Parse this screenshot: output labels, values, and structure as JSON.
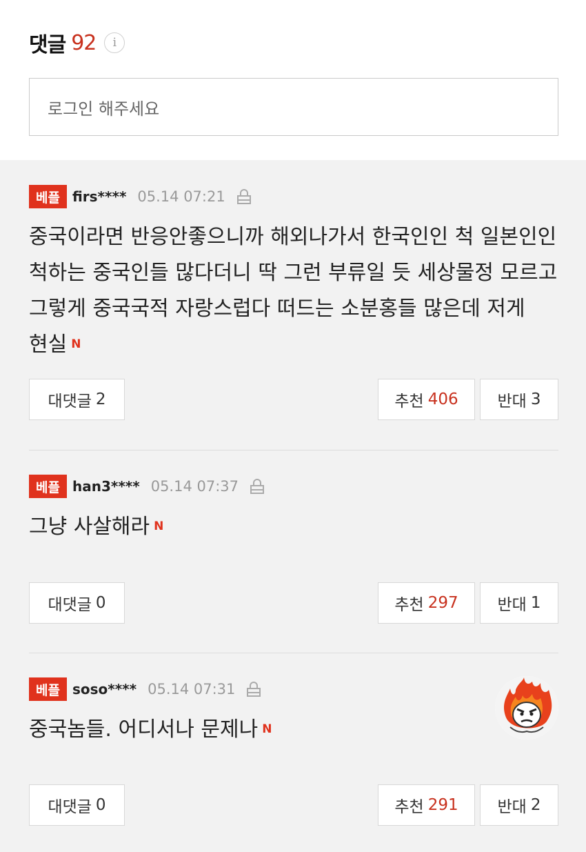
{
  "header": {
    "title": "댓글",
    "count": "92",
    "info_icon": "info-icon",
    "login_placeholder": "로그인 해주세요"
  },
  "comments": [
    {
      "badge": "베플",
      "user": "firs****",
      "time": "05.14 07:21",
      "text": "중국이라면 반응안좋으니까 해외나가서 한국인인 척 일본인인 척하는 중국인들 많다더니 딱 그런 부류일 듯 세상물정 모르고 그렇게 중국국적 자랑스럽다 떠드는 소분홍들 많은데 저게 현실",
      "new_mark": "N",
      "reply_label": "대댓글",
      "reply_count": "2",
      "like_label": "추천",
      "like_count": "406",
      "dislike_label": "반대",
      "dislike_count": "3"
    },
    {
      "badge": "베플",
      "user": "han3****",
      "time": "05.14 07:37",
      "text": "그냥 사살해라",
      "new_mark": "N",
      "reply_label": "대댓글",
      "reply_count": "0",
      "like_label": "추천",
      "like_count": "297",
      "dislike_label": "반대",
      "dislike_count": "1"
    },
    {
      "badge": "베플",
      "user": "soso****",
      "time": "05.14 07:31",
      "text": "중국놈들. 어디서나 문제나",
      "new_mark": "N",
      "reply_label": "대댓글",
      "reply_count": "0",
      "like_label": "추천",
      "like_count": "291",
      "dislike_label": "반대",
      "dislike_count": "2",
      "avatar_icon": "flame-angry-face-icon"
    }
  ],
  "colors": {
    "accent": "#c8311e",
    "badge": "#e0321d",
    "list_background": "#f2f2f2"
  }
}
